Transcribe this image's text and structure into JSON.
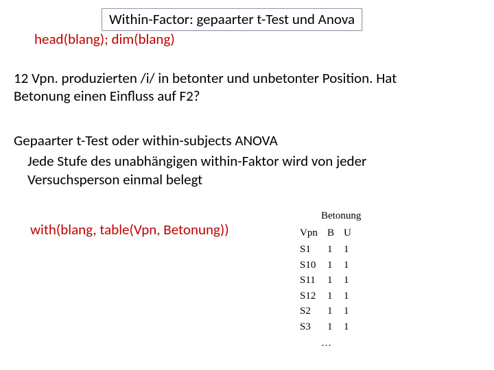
{
  "title": "Within-Factor: gepaarter t-Test und Anova",
  "cmd1": "head(blang); dim(blang)",
  "para1": "12 Vpn. produzierten /i/ in betonter und unbetonter Position. Hat Betonung einen Einfluss auf F2?",
  "para2_lead": "Gepaarter t-Test oder within-subjects ANOVA",
  "para2_body": "Jede Stufe des unabhängigen within-Faktor wird von jeder Versuchsperson einmal belegt",
  "cmd2": "with(blang, table(Vpn, Betonung))",
  "table": {
    "super_header": "Betonung",
    "col_headers": [
      "Vpn",
      "B",
      "U"
    ],
    "rows": [
      {
        "vpn": "S1",
        "b": "1",
        "u": "1"
      },
      {
        "vpn": "S10",
        "b": "1",
        "u": "1"
      },
      {
        "vpn": "S11",
        "b": "1",
        "u": "1"
      },
      {
        "vpn": "S12",
        "b": "1",
        "u": "1"
      },
      {
        "vpn": "S2",
        "b": "1",
        "u": "1"
      },
      {
        "vpn": "S3",
        "b": "1",
        "u": "1"
      }
    ],
    "ellipsis": "…"
  }
}
